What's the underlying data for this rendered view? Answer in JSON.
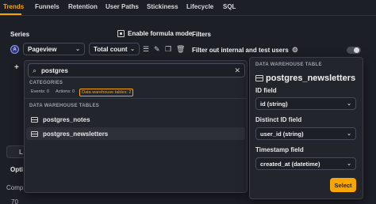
{
  "tabs": [
    {
      "label": "Trends",
      "active": true
    },
    {
      "label": "Funnels"
    },
    {
      "label": "Retention"
    },
    {
      "label": "User Paths"
    },
    {
      "label": "Stickiness"
    },
    {
      "label": "Lifecycle"
    },
    {
      "label": "SQL"
    }
  ],
  "series": {
    "heading": "Series",
    "formula_label": "Enable formula mode",
    "badge": "A",
    "event_select": "Pageview",
    "math_select": "Total count",
    "add_symbol": "+"
  },
  "filters": {
    "heading": "Filters",
    "internal_label": "Filter out internal and test users",
    "internal_enabled": false
  },
  "dropdown": {
    "search_value": "postgres",
    "categories_heading": "CATEGORIES",
    "chips": [
      {
        "label": "Events: 0"
      },
      {
        "label": "Actions: 0"
      },
      {
        "label": "Data warehouse tables: 2",
        "active": true
      }
    ],
    "tables_heading": "DATA WAREHOUSE TABLES",
    "items": [
      {
        "label": "postgres_notes"
      },
      {
        "label": "postgres_newsletters",
        "highlighted": true
      }
    ]
  },
  "panel": {
    "heading": "DATA WAREHOUSE TABLE",
    "title": "postgres_newsletters",
    "id_label": "ID field",
    "id_value": "id (string)",
    "distinct_label": "Distinct ID field",
    "distinct_value": "user_id (string)",
    "timestamp_label": "Timestamp field",
    "timestamp_value": "created_at (datetime)",
    "select_label": "Select"
  },
  "background": {
    "card_text": "L",
    "options_text": "Opti",
    "comp_text": "Comp",
    "num_text": "70"
  },
  "colors": {
    "accent": "#f7a501",
    "background": "#1d1f27",
    "surface": "#23252d"
  }
}
